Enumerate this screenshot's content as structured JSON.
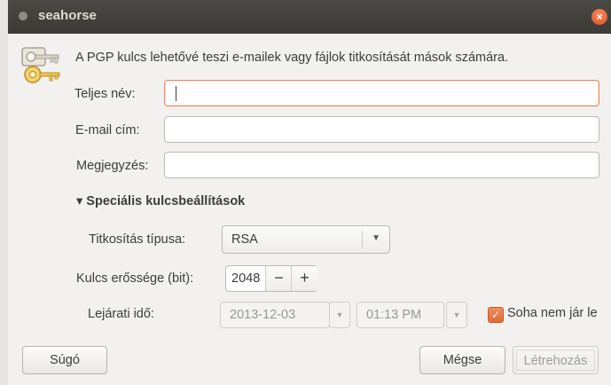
{
  "window": {
    "title": "seahorse",
    "close_glyph": "×"
  },
  "intro_text": "A PGP kulcs lehetővé teszi e-mailek vagy fájlok titkosítását mások számára.",
  "fields": {
    "full_name": {
      "label": "Teljes név:",
      "value": ""
    },
    "email": {
      "label": "E-mail cím:",
      "value": ""
    },
    "comment": {
      "label": "Megjegyzés:",
      "value": ""
    }
  },
  "advanced": {
    "expander_label": "▾ Speciális kulcsbeállítások",
    "encryption_type": {
      "label": "Titkosítás típusa:",
      "selected": "RSA"
    },
    "key_strength": {
      "label": "Kulcs erőssége (bit):",
      "value": "2048",
      "minus": "−",
      "plus": "+"
    },
    "expiry": {
      "label": "Lejárati idő:",
      "date": "2013-12-03",
      "time": "01:13 PM",
      "never_expires_label": "Soha nem jár le",
      "never_expires_checked": true
    }
  },
  "buttons": {
    "help": "Súgó",
    "cancel": "Mégse",
    "create": "Létrehozás"
  },
  "colors": {
    "accent": "#e9692f",
    "titlebar": "#3c3b37"
  }
}
